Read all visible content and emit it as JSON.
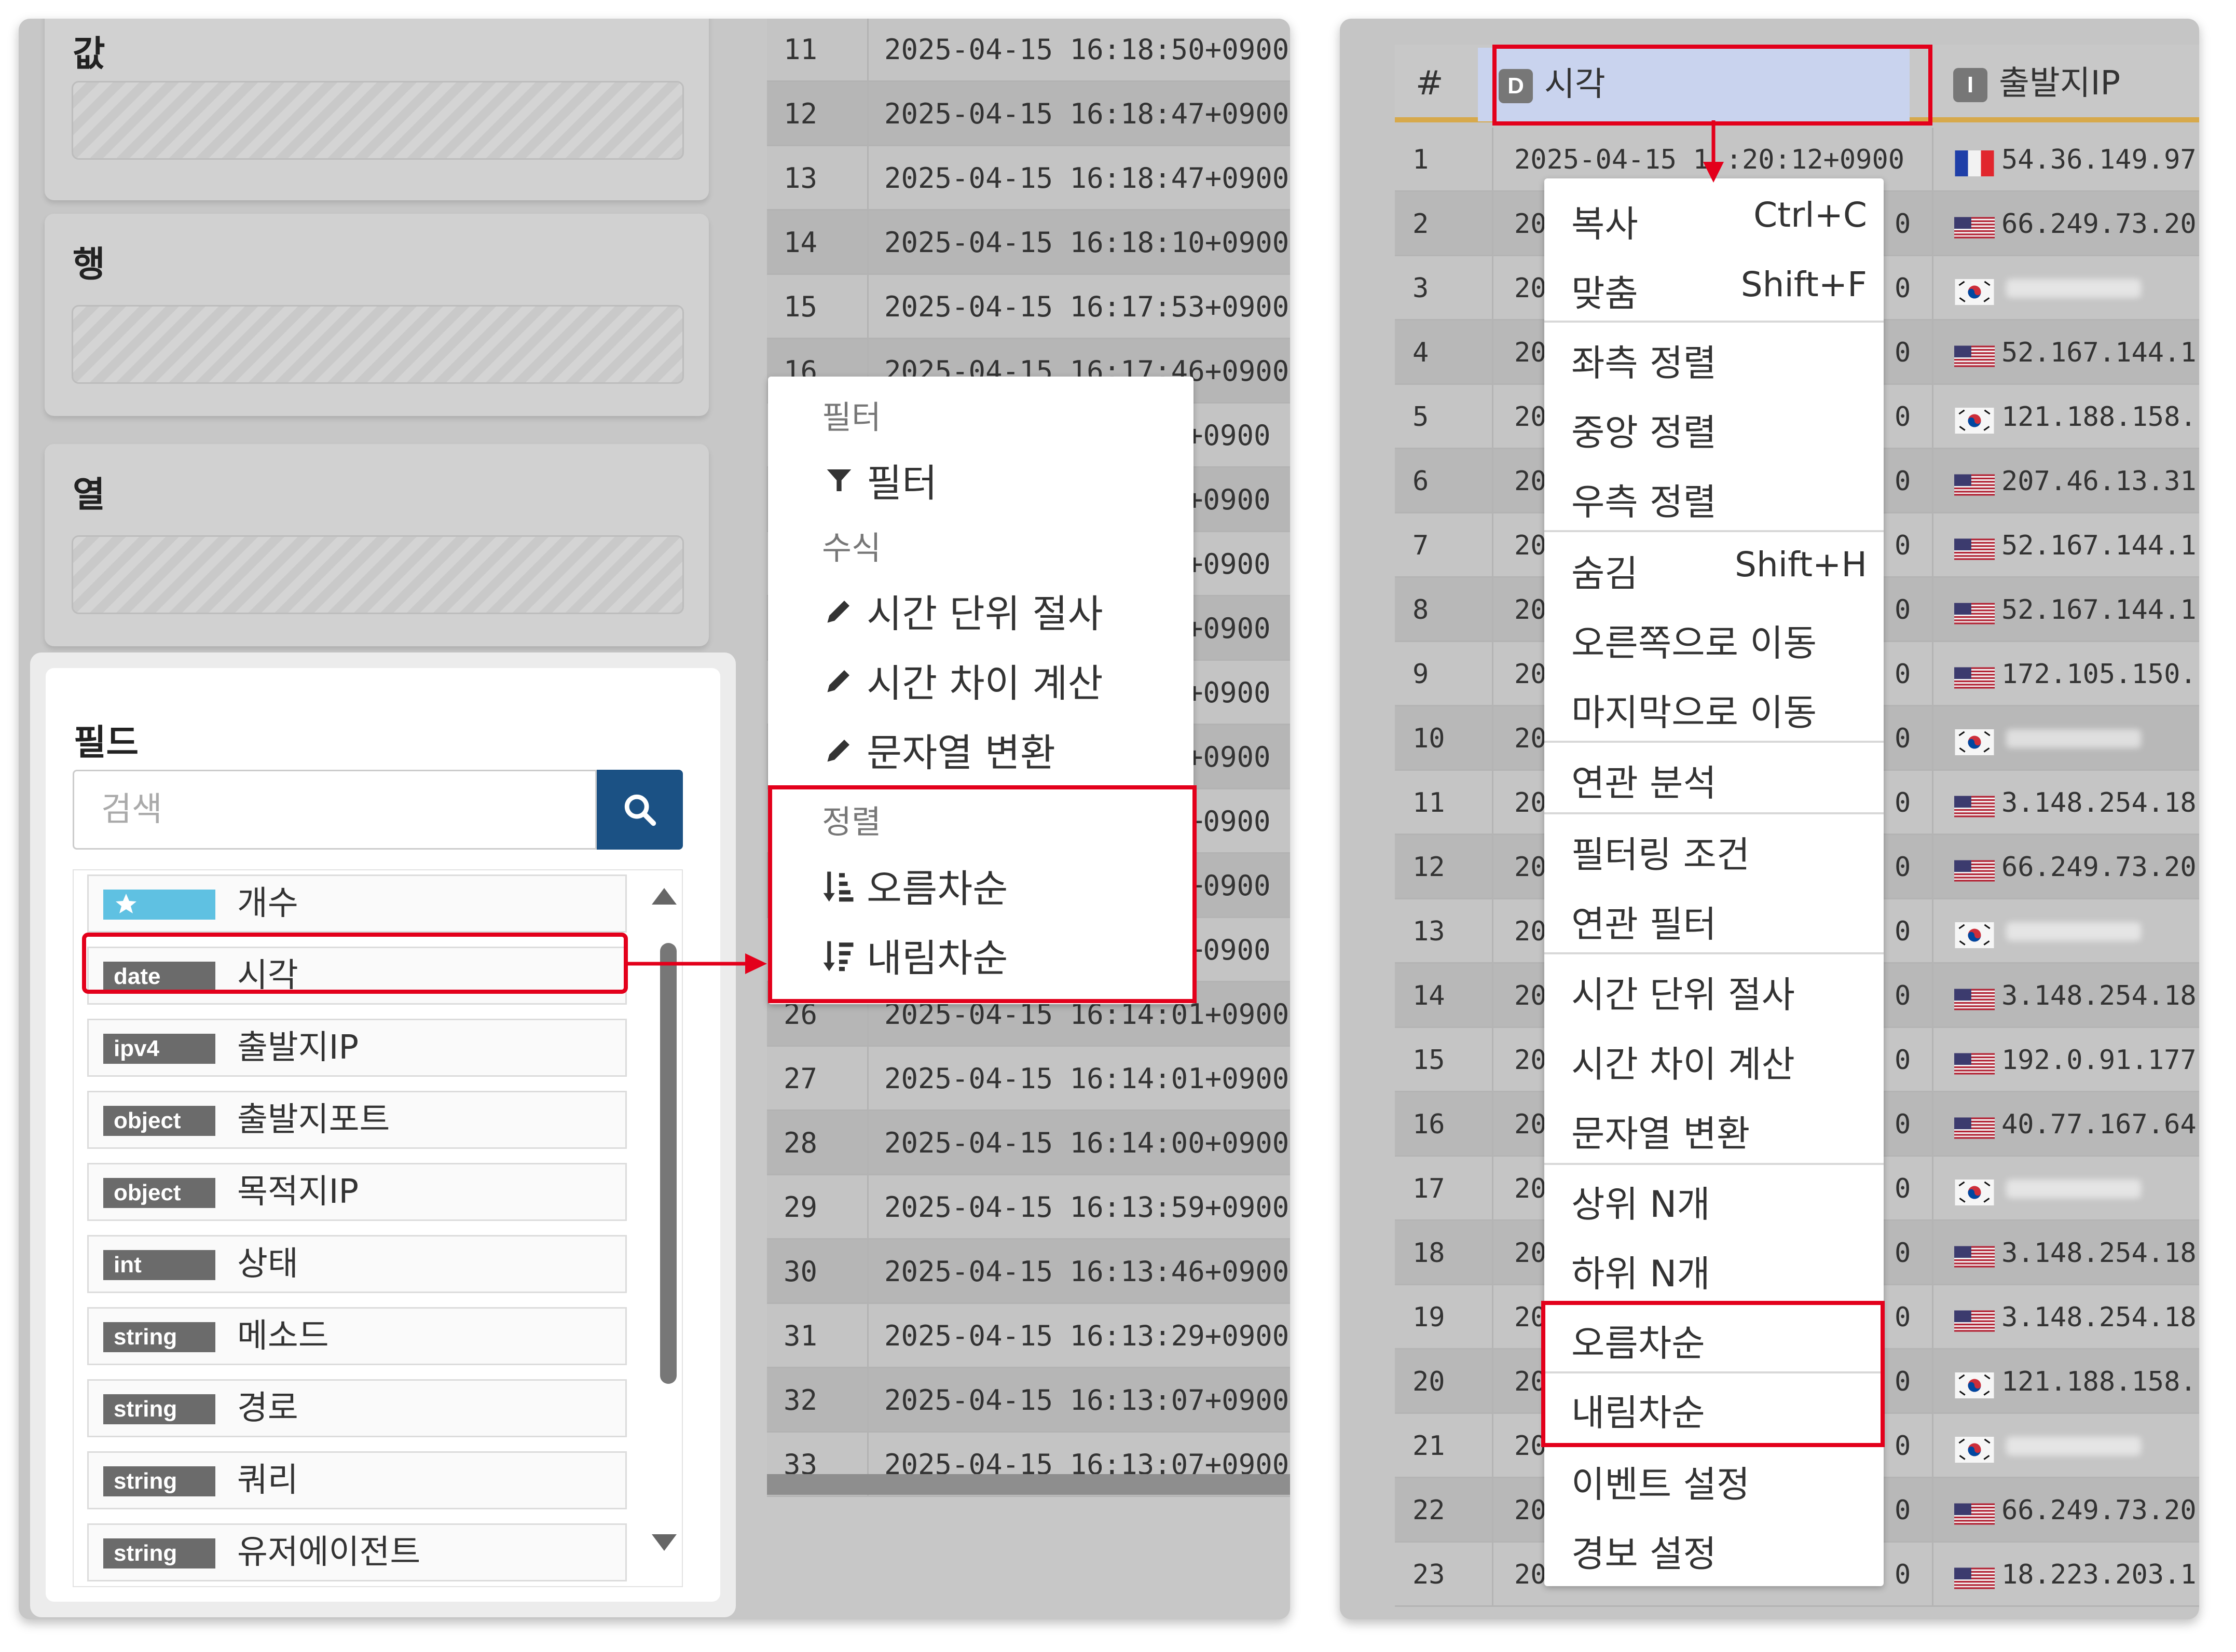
{
  "left": {
    "drop_zones": [
      "값",
      "행",
      "열"
    ],
    "table_rows": [
      {
        "n": "11",
        "t": "2025-04-15 16:18:50+0900"
      },
      {
        "n": "12",
        "t": "2025-04-15 16:18:47+0900"
      },
      {
        "n": "13",
        "t": "2025-04-15 16:18:47+0900"
      },
      {
        "n": "14",
        "t": "2025-04-15 16:18:10+0900"
      },
      {
        "n": "15",
        "t": "2025-04-15 16:17:53+0900"
      },
      {
        "n": "16",
        "t": "2025-04-15 16:17:46+0900"
      },
      {
        "n": "",
        "t": "+0900"
      },
      {
        "n": "",
        "t": "+0900"
      },
      {
        "n": "",
        "t": "+0900"
      },
      {
        "n": "",
        "t": "+0900"
      },
      {
        "n": "",
        "t": "+0900"
      },
      {
        "n": "",
        "t": "+0900"
      },
      {
        "n": "",
        "t": "+0900"
      },
      {
        "n": "",
        "t": "+0900"
      },
      {
        "n": "",
        "t": "+0900"
      },
      {
        "n": "26",
        "t": "2025-04-15 16:14:01+0900"
      },
      {
        "n": "27",
        "t": "2025-04-15 16:14:01+0900"
      },
      {
        "n": "28",
        "t": "2025-04-15 16:14:00+0900"
      },
      {
        "n": "29",
        "t": "2025-04-15 16:13:59+0900"
      },
      {
        "n": "30",
        "t": "2025-04-15 16:13:46+0900"
      },
      {
        "n": "31",
        "t": "2025-04-15 16:13:29+0900"
      },
      {
        "n": "32",
        "t": "2025-04-15 16:13:07+0900"
      },
      {
        "n": "33",
        "t": "2025-04-15 16:13:07+0900"
      }
    ],
    "fields_title": "필드",
    "search_placeholder": "검색",
    "fields": [
      {
        "type": "",
        "label": "개수",
        "star": true
      },
      {
        "type": "date",
        "label": "시각"
      },
      {
        "type": "ipv4",
        "label": "출발지IP"
      },
      {
        "type": "object",
        "label": "출발지포트"
      },
      {
        "type": "object",
        "label": "목적지IP"
      },
      {
        "type": "int",
        "label": "상태"
      },
      {
        "type": "string",
        "label": "메소드"
      },
      {
        "type": "string",
        "label": "경로"
      },
      {
        "type": "string",
        "label": "쿼리"
      },
      {
        "type": "string",
        "label": "유저에이전트"
      }
    ],
    "menu": {
      "sec_filter": "필터",
      "filter": "필터",
      "sec_formula": "수식",
      "time_trunc": "시간 단위 절사",
      "time_diff": "시간 차이 계산",
      "str_convert": "문자열 변환",
      "sec_sort": "정렬",
      "asc": "오름차순",
      "desc": "내림차순"
    }
  },
  "right": {
    "headers": {
      "num": "#",
      "time": "시각",
      "time_badge": "D",
      "ip": "출발지IP",
      "ip_badge": "I"
    },
    "first_row_time": "2025-04-15 1",
    "first_row_time_end": ":20:12+0900",
    "rows": [
      {
        "n": "1",
        "ip": "54.36.149.97",
        "flag": "fr"
      },
      {
        "n": "2",
        "ip": "66.249.73.20",
        "flag": "us"
      },
      {
        "n": "3",
        "ip": "",
        "flag": "kr"
      },
      {
        "n": "4",
        "ip": "52.167.144.1",
        "flag": "us"
      },
      {
        "n": "5",
        "ip": "121.188.158.",
        "flag": "kr"
      },
      {
        "n": "6",
        "ip": "207.46.13.31",
        "flag": "us"
      },
      {
        "n": "7",
        "ip": "52.167.144.1",
        "flag": "us"
      },
      {
        "n": "8",
        "ip": "52.167.144.1",
        "flag": "us"
      },
      {
        "n": "9",
        "ip": "172.105.150.",
        "flag": "us"
      },
      {
        "n": "10",
        "ip": "",
        "flag": "kr"
      },
      {
        "n": "11",
        "ip": "3.148.254.18",
        "flag": "us"
      },
      {
        "n": "12",
        "ip": "66.249.73.20",
        "flag": "us"
      },
      {
        "n": "13",
        "ip": "",
        "flag": "kr"
      },
      {
        "n": "14",
        "ip": "3.148.254.18",
        "flag": "us"
      },
      {
        "n": "15",
        "ip": "192.0.91.177",
        "flag": "us"
      },
      {
        "n": "16",
        "ip": "40.77.167.64",
        "flag": "us"
      },
      {
        "n": "17",
        "ip": "",
        "flag": "kr"
      },
      {
        "n": "18",
        "ip": "3.148.254.18",
        "flag": "us"
      },
      {
        "n": "19",
        "ip": "3.148.254.18",
        "flag": "us"
      },
      {
        "n": "20",
        "ip": "121.188.158.",
        "flag": "kr"
      },
      {
        "n": "21",
        "ip": "",
        "flag": "kr"
      },
      {
        "n": "22",
        "ip": "66.249.73.20",
        "flag": "us"
      },
      {
        "n": "23",
        "ip": "18.223.203.1",
        "flag": "us"
      }
    ],
    "row_time_prefix": "20",
    "row_time_suffix": "0",
    "menu": [
      {
        "label": "복사",
        "shortcut": "Ctrl+C"
      },
      {
        "label": "맞춤",
        "shortcut": "Shift+F"
      },
      {
        "label": "좌측 정렬",
        "shortcut": ""
      },
      {
        "label": "중앙 정렬",
        "shortcut": ""
      },
      {
        "label": "우측 정렬",
        "shortcut": ""
      },
      {
        "label": "숨김",
        "shortcut": "Shift+H"
      },
      {
        "label": "오른쪽으로 이동",
        "shortcut": ""
      },
      {
        "label": "마지막으로 이동",
        "shortcut": ""
      },
      {
        "label": "연관 분석",
        "shortcut": ""
      },
      {
        "label": "필터링 조건",
        "shortcut": ""
      },
      {
        "label": "연관 필터",
        "shortcut": ""
      },
      {
        "label": "시간 단위 절사",
        "shortcut": ""
      },
      {
        "label": "시간 차이 계산",
        "shortcut": ""
      },
      {
        "label": "문자열 변환",
        "shortcut": ""
      },
      {
        "label": "상위 N개",
        "shortcut": ""
      },
      {
        "label": "하위 N개",
        "shortcut": ""
      },
      {
        "label": "오름차순",
        "shortcut": ""
      },
      {
        "label": "내림차순",
        "shortcut": ""
      },
      {
        "label": "이벤트 설정",
        "shortcut": ""
      },
      {
        "label": "경보 설정",
        "shortcut": ""
      }
    ]
  },
  "colors": {
    "highlight": "#e3001b",
    "search_button": "#1b5184",
    "header_underline": "#d7a94b",
    "time_header": "#c9d3ee"
  }
}
